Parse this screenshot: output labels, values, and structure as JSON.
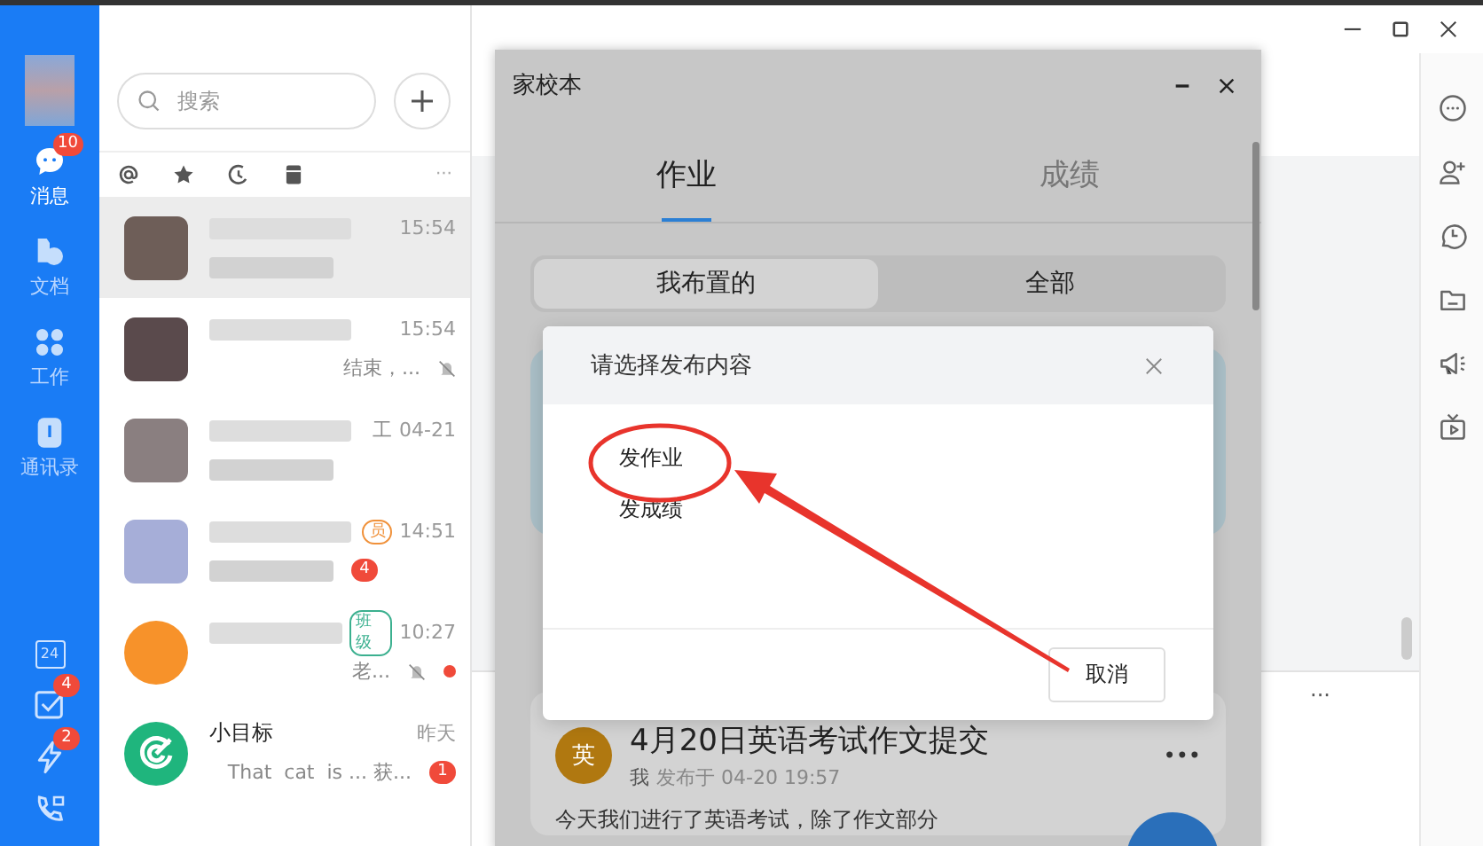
{
  "nav": {
    "items": [
      {
        "kind": "message",
        "label": "消息",
        "selected": true,
        "badge": "10"
      },
      {
        "kind": "docs",
        "label": "文档",
        "selected": false
      },
      {
        "kind": "work",
        "label": "工作",
        "selected": false
      },
      {
        "kind": "contacts",
        "label": "通讯录",
        "selected": false
      }
    ],
    "tools": [
      {
        "kind": "calendar",
        "text": "24"
      },
      {
        "kind": "todo",
        "badge": "4"
      },
      {
        "kind": "ding",
        "badge": "2"
      },
      {
        "kind": "call"
      }
    ]
  },
  "search": {
    "placeholder": "搜索"
  },
  "filters": [
    {
      "kind": "at"
    },
    {
      "kind": "star"
    },
    {
      "kind": "recent"
    },
    {
      "kind": "archive"
    }
  ],
  "filter_more": "···",
  "chats": [
    {
      "avatar": {
        "kind": "blurred",
        "color": "#6e5e58"
      },
      "time": "15:54",
      "selected": true,
      "muted": false,
      "unread_dot": false
    },
    {
      "avatar": {
        "kind": "blurred",
        "color": "#5a4a4c"
      },
      "time": "15:54",
      "preview": "结束，...",
      "selected": false,
      "muted": true,
      "unread_dot": false
    },
    {
      "avatar": {
        "kind": "blurred",
        "color": "#8a7f80"
      },
      "time": "04-21",
      "name_tail": "工",
      "selected": false,
      "muted": false,
      "unread_dot": false
    },
    {
      "avatar": {
        "kind": "blurred",
        "color": "#a6aed8"
      },
      "time": "14:51",
      "tag": {
        "text": "员",
        "color": "#f0913a"
      },
      "badge": "4",
      "selected": false,
      "muted": false,
      "unread_dot": false
    },
    {
      "avatar": {
        "kind": "folder",
        "color": "#f7922a"
      },
      "time": "10:27",
      "tag": {
        "text": "班级",
        "color": "#3bb08f"
      },
      "preview": "老...",
      "selected": false,
      "muted": true,
      "unread_dot": true
    },
    {
      "avatar": {
        "kind": "target",
        "color": "#1fb57d"
      },
      "name": "小目标",
      "time": "昨天",
      "preview": "That  cat  is ... 获...",
      "badge": "1",
      "selected": false,
      "muted": false,
      "unread_dot": false
    }
  ],
  "main": {
    "more": "···"
  },
  "toolbar": [
    {
      "kind": "more"
    },
    {
      "kind": "add-person"
    },
    {
      "kind": "history"
    },
    {
      "kind": "folder"
    },
    {
      "kind": "announce"
    },
    {
      "kind": "live"
    }
  ],
  "window": {
    "title": "家校本",
    "tabs": [
      {
        "label": "作业",
        "selected": true
      },
      {
        "label": "成绩",
        "selected": false
      }
    ],
    "segments": [
      {
        "label": "我布置的",
        "selected": true
      },
      {
        "label": "全部",
        "selected": false
      }
    ],
    "post": {
      "avatar": "英",
      "title": "4月20日英语考试作文提交",
      "author": "我",
      "meta": "发布于 04-20 19:57",
      "more": "•••",
      "body": "今天我们进行了英语考试，除了作文部分"
    }
  },
  "dialog": {
    "title": "请选择发布内容",
    "options": [
      "发作业",
      "发成绩"
    ],
    "cancel": "取消"
  }
}
